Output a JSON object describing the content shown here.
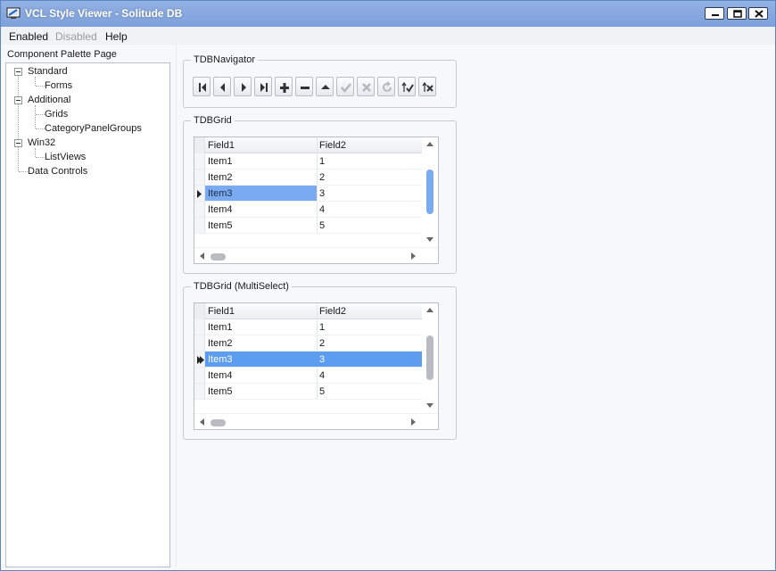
{
  "window": {
    "title": "VCL Style Viewer - Solitude DB",
    "controls": [
      "minimize",
      "maximize",
      "close"
    ]
  },
  "menu": {
    "items": [
      {
        "label": "Enabled",
        "enabled": true
      },
      {
        "label": "Disabled",
        "enabled": false
      },
      {
        "label": "Help",
        "enabled": true
      }
    ]
  },
  "tree": {
    "label": "Component Palette Page",
    "nodes": [
      {
        "label": "Standard",
        "expanded": true,
        "children": [
          "Forms"
        ]
      },
      {
        "label": "Additional",
        "expanded": true,
        "children": [
          "Grids",
          "CategoryPanelGroups"
        ]
      },
      {
        "label": "Win32",
        "expanded": true,
        "children": [
          "ListViews"
        ]
      },
      {
        "label": "Data Controls",
        "expanded": false,
        "children": []
      }
    ]
  },
  "navigator": {
    "label": "TDBNavigator",
    "buttons": [
      {
        "name": "first",
        "icon": "first-record-icon",
        "enabled": true
      },
      {
        "name": "prior",
        "icon": "prior-record-icon",
        "enabled": true
      },
      {
        "name": "next",
        "icon": "next-record-icon",
        "enabled": true
      },
      {
        "name": "last",
        "icon": "last-record-icon",
        "enabled": true
      },
      {
        "name": "insert",
        "icon": "plus-icon",
        "enabled": true
      },
      {
        "name": "delete",
        "icon": "minus-icon",
        "enabled": true
      },
      {
        "name": "edit",
        "icon": "triangle-up-icon",
        "enabled": true
      },
      {
        "name": "post",
        "icon": "check-icon",
        "enabled": false
      },
      {
        "name": "cancel",
        "icon": "x-icon",
        "enabled": false
      },
      {
        "name": "refresh",
        "icon": "refresh-icon",
        "enabled": false
      },
      {
        "name": "apply-updates",
        "icon": "apply-updates-icon",
        "enabled": true
      },
      {
        "name": "cancel-updates",
        "icon": "cancel-updates-icon",
        "enabled": true
      }
    ]
  },
  "grid1": {
    "label": "TDBGrid",
    "columns": [
      "Field1",
      "Field2"
    ],
    "rows": [
      [
        "Item1",
        "1"
      ],
      [
        "Item2",
        "2"
      ],
      [
        "Item3",
        "3"
      ],
      [
        "Item4",
        "4"
      ],
      [
        "Item5",
        "5"
      ]
    ],
    "selected_row": 2,
    "scroll_thumb_color": "#7aaaf0"
  },
  "grid2": {
    "label": "TDBGrid (MultiSelect)",
    "columns": [
      "Field1",
      "Field2"
    ],
    "rows": [
      [
        "Item1",
        "1"
      ],
      [
        "Item2",
        "2"
      ],
      [
        "Item3",
        "3"
      ],
      [
        "Item4",
        "4"
      ],
      [
        "Item5",
        "5"
      ]
    ],
    "selected_row": 2,
    "scroll_thumb_color": "#b8bcc2"
  },
  "colors": {
    "titlebar": "#8aaae0",
    "selection": "#7aaaf0",
    "multiselect_selection": "#5d9df0"
  }
}
